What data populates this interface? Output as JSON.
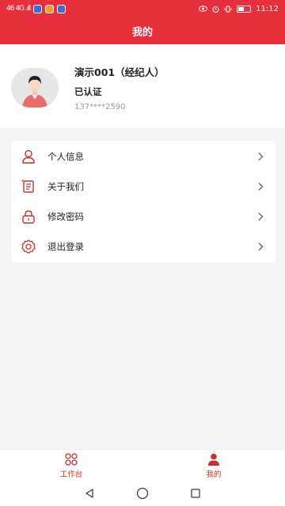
{
  "status_bar": {
    "left_text": "46  4G  .ıll",
    "time": "11:12",
    "battery": "42"
  },
  "header": {
    "title": "我的"
  },
  "profile": {
    "name": "演示001（经纪人）",
    "verified": "已认证",
    "phone": "137****2590"
  },
  "menu": {
    "items": [
      {
        "label": "个人信息",
        "icon": "person-icon"
      },
      {
        "label": "关于我们",
        "icon": "scroll-icon"
      },
      {
        "label": "修改密码",
        "icon": "lock-icon"
      },
      {
        "label": "退出登录",
        "icon": "gear-icon"
      }
    ]
  },
  "tabbar": {
    "tabs": [
      {
        "label": "工作台",
        "icon": "grid-icon"
      },
      {
        "label": "我的",
        "icon": "user-icon",
        "active": true
      }
    ]
  },
  "colors": {
    "brand_red": "#e8303d",
    "icon_red": "#c9302e"
  }
}
